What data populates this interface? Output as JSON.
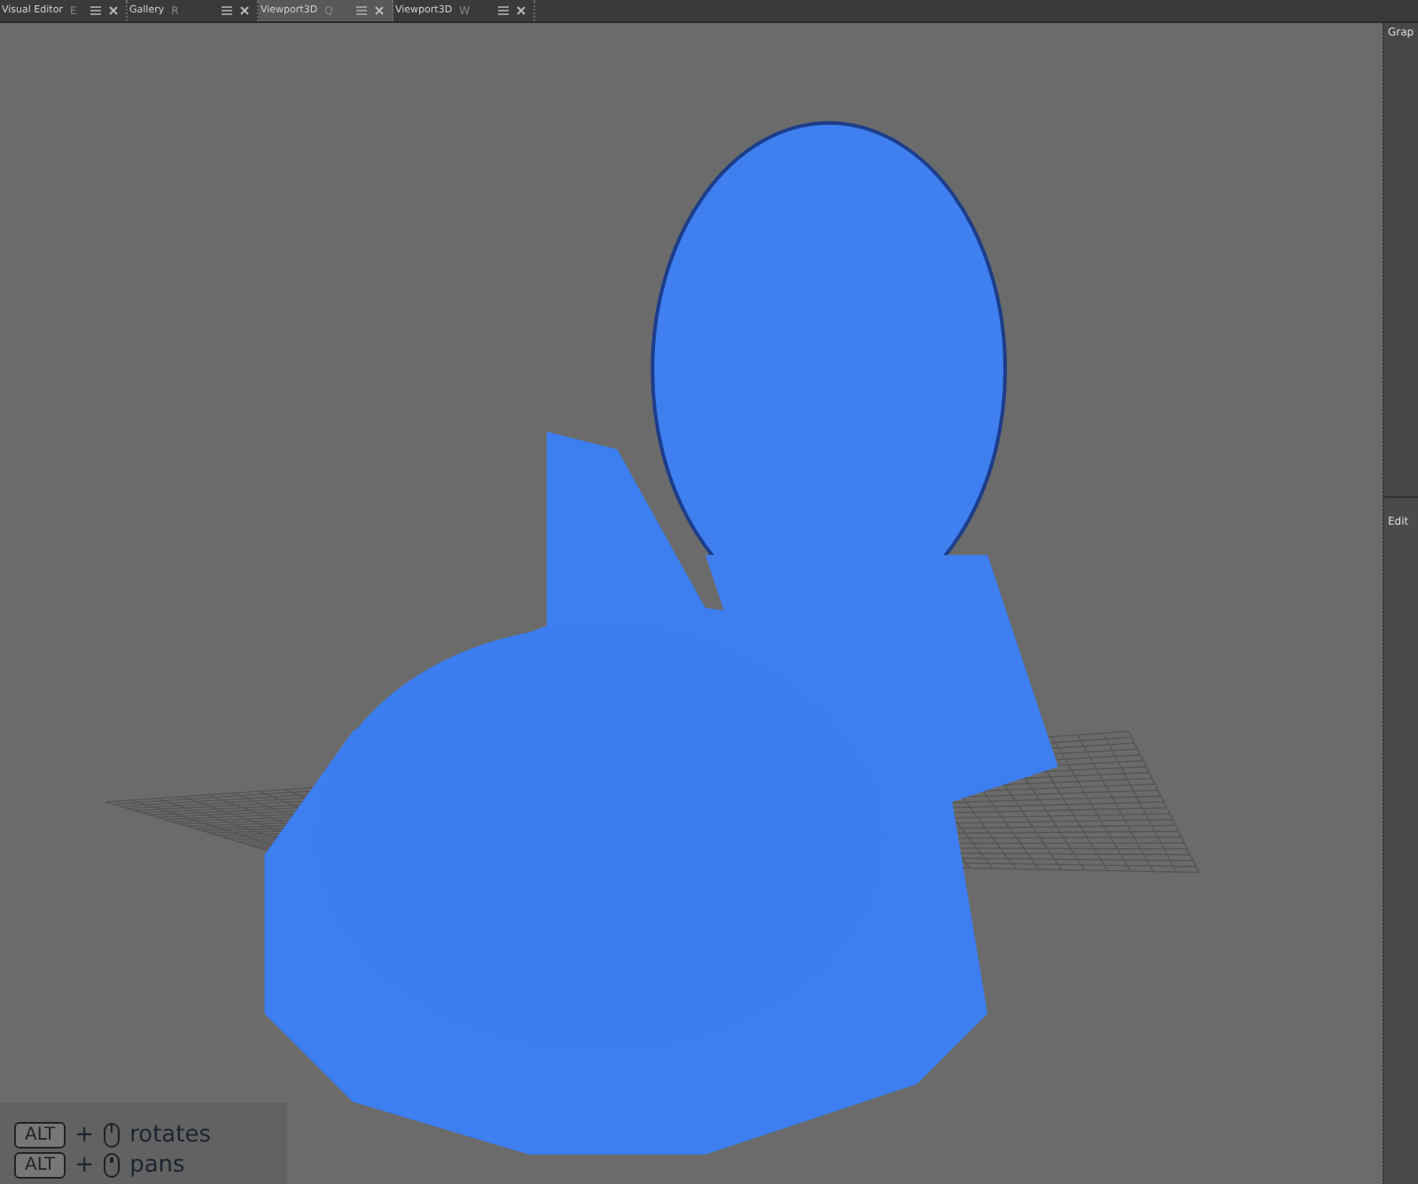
{
  "tabs": [
    {
      "label": "Visual Editor",
      "shortcut": "E",
      "selected": false
    },
    {
      "label": "Gallery",
      "shortcut": "R",
      "selected": false
    },
    {
      "label": "Viewport3D",
      "shortcut": "Q",
      "selected": true
    },
    {
      "label": "Viewport3D",
      "shortcut": "W",
      "selected": false
    }
  ],
  "side_panel": {
    "top_label": "Grap",
    "lower_label": "Edit"
  },
  "hints": [
    {
      "kind": "left",
      "key": "ALT",
      "plus": "+",
      "action": "rotates"
    },
    {
      "kind": "middle",
      "key": "ALT",
      "plus": "+",
      "action": "pans"
    }
  ]
}
